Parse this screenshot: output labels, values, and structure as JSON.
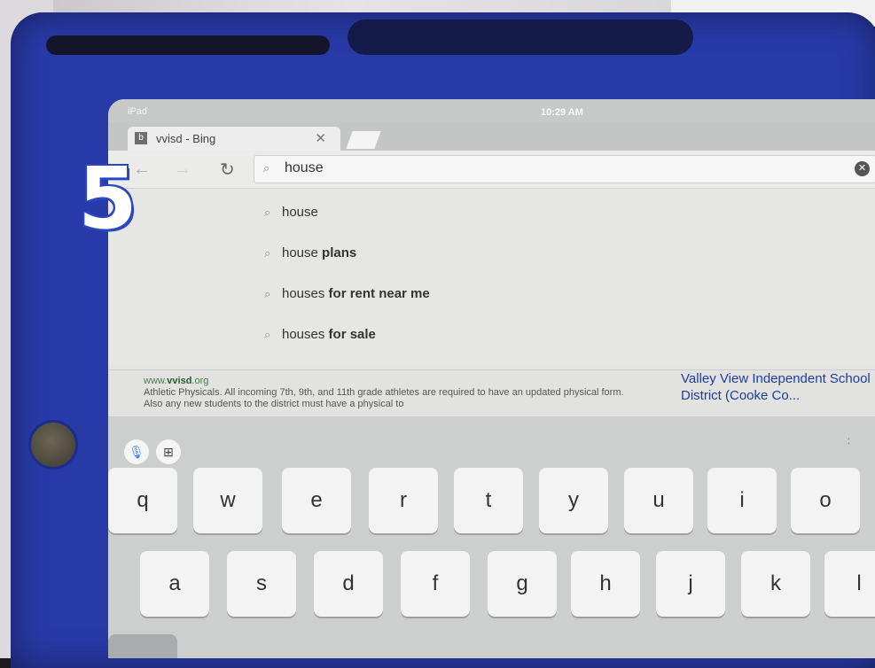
{
  "status": {
    "device": "iPad",
    "time": "10:29 AM"
  },
  "tab": {
    "title": "vvisd - Bing"
  },
  "toolbar": {
    "query": "house"
  },
  "suggestions": [
    {
      "base": "house",
      "bold": ""
    },
    {
      "base": "house",
      "bold": " plans"
    },
    {
      "base": "houses",
      "bold": " for rent near me"
    },
    {
      "base": "houses",
      "bold": " for sale"
    }
  ],
  "result": {
    "url_pre": "www.",
    "url_bold": "vvisd",
    "url_post": ".org",
    "snippet": "Athletic Physicals. All incoming 7th, 9th, and 11th grade athletes are required to have an updated physical form. Also any new students to the district must have a physical to",
    "title": "Valley View Independent School District (Cooke Co..."
  },
  "keyboard": {
    "row1": [
      "q",
      "w",
      "e",
      "r",
      "t",
      "y",
      "u",
      "i",
      "o"
    ],
    "row2": [
      "a",
      "s",
      "d",
      "f",
      "g",
      "h",
      "j",
      "k",
      "l"
    ],
    "more": ":"
  },
  "overlay": {
    "step_number": "5"
  },
  "colors": {
    "case": "#283aa8",
    "result_title": "#1e3c9a"
  }
}
